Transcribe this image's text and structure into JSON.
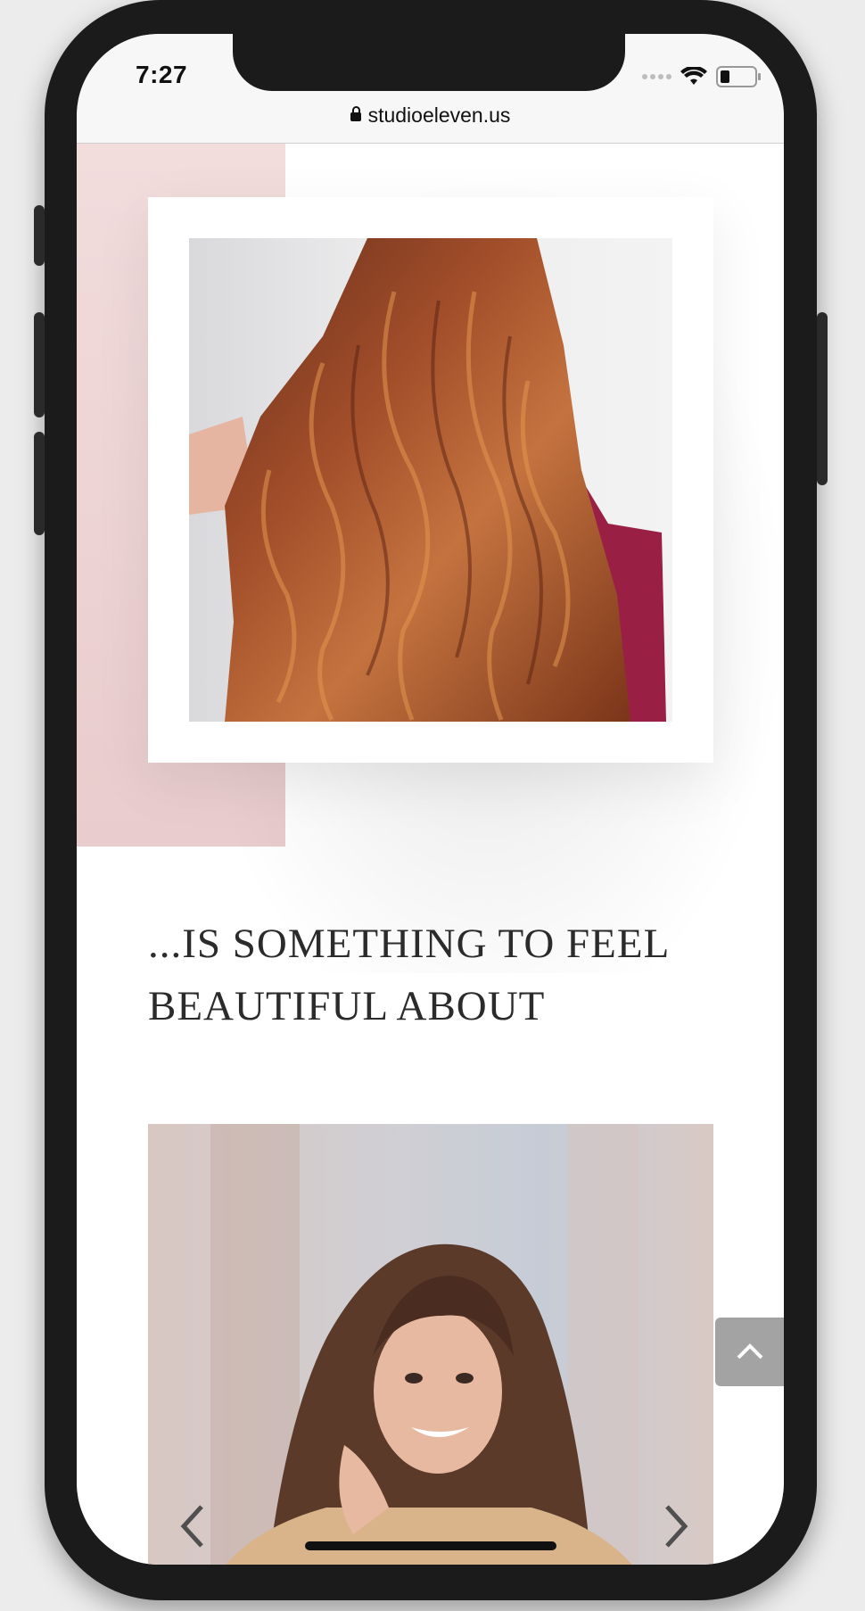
{
  "status_bar": {
    "time": "7:27",
    "url": "studioeleven.us"
  },
  "hero": {
    "image_alt": "long wavy auburn hair seen from behind"
  },
  "heading": {
    "text": "...IS SOMETHING TO FEEL BEAUTIFUL ABOUT"
  },
  "slider": {
    "image_alt": "smiling woman with long brown hair",
    "prev_icon": "chevron-left-icon",
    "next_icon": "chevron-right-icon"
  },
  "back_to_top": {
    "icon": "chevron-up-icon"
  },
  "colors": {
    "pink_accent": "#ecd3d3",
    "heading_text": "#2b2b2b",
    "to_top_bg": "#a3a3a3"
  }
}
